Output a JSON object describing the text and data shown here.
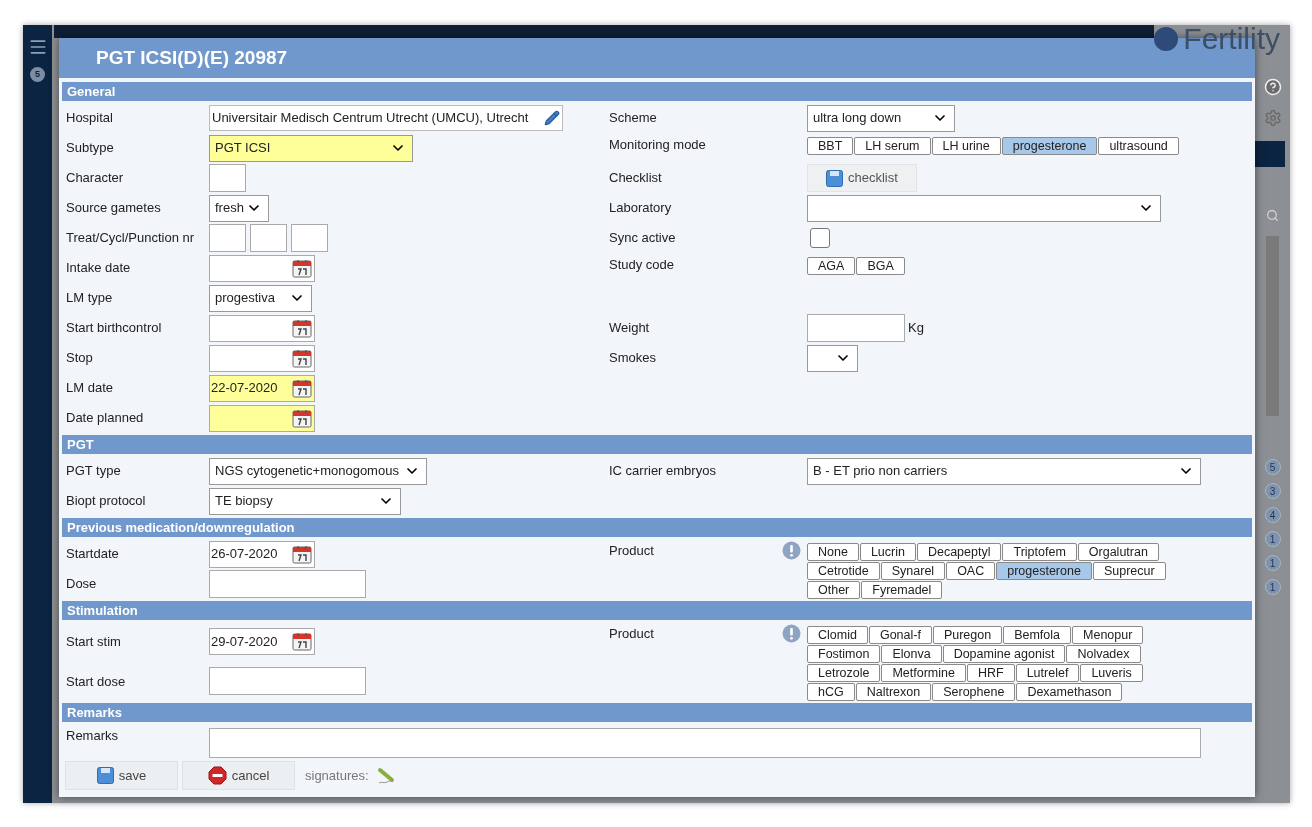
{
  "app": {
    "menu_badge": "5",
    "logo": "Fertility",
    "side_badges": [
      "5",
      "3",
      "4",
      "1",
      "1",
      "1"
    ]
  },
  "dialog": {
    "title": "PGT ICSI(D)(E) 20987"
  },
  "sections": [
    {
      "title": "General",
      "rows": [
        {
          "left": {
            "label": "Hospital",
            "kind": "lookup",
            "value": "Universitair Medisch Centrum Utrecht (UMCU), Utrecht",
            "highlighted": false
          },
          "right": {
            "label": "Scheme",
            "kind": "select",
            "value": "ultra long down",
            "highlighted": false
          }
        },
        {
          "left": {
            "label": "Subtype",
            "kind": "select",
            "value": "PGT ICSI",
            "highlighted": true
          },
          "right": {
            "label": "Monitoring mode",
            "kind": "toggles",
            "options": [
              {
                "label": "BBT",
                "selected": false
              },
              {
                "label": "LH serum",
                "selected": false
              },
              {
                "label": "LH urine",
                "selected": false
              },
              {
                "label": "progesterone",
                "selected": true
              },
              {
                "label": "ultrasound",
                "selected": false
              }
            ]
          }
        },
        {
          "left": {
            "label": "Character",
            "kind": "text",
            "highlighted": false
          },
          "right": {
            "label": "Checklist",
            "kind": "action",
            "button": "checklist"
          }
        },
        {
          "left": {
            "label": "Source gametes",
            "kind": "select",
            "value": "fresh",
            "highlighted": false
          },
          "right": {
            "label": "Laboratory",
            "kind": "select",
            "highlighted": false
          }
        },
        {
          "left": {
            "label": "Treat/Cycl/Punction nr",
            "kind": "triple"
          },
          "right": {
            "label": "Sync active",
            "kind": "checkbox",
            "checked": false
          }
        },
        {
          "left": {
            "label": "Intake date",
            "kind": "date",
            "highlighted": false
          },
          "right": {
            "label": "Study code",
            "kind": "toggles",
            "options": [
              {
                "label": "AGA",
                "selected": false
              },
              {
                "label": "BGA",
                "selected": false
              }
            ]
          }
        },
        {
          "left": {
            "label": "LM type",
            "kind": "select",
            "value": "progestiva",
            "highlighted": false
          }
        },
        {
          "left": {
            "label": "Start birthcontrol",
            "kind": "date",
            "highlighted": false
          },
          "right": {
            "label": "Weight",
            "kind": "measure",
            "unit": "Kg",
            "highlighted": false
          }
        },
        {
          "left": {
            "label": "Stop",
            "kind": "date",
            "highlighted": false
          },
          "right": {
            "label": "Smokes",
            "kind": "select",
            "highlighted": false
          }
        },
        {
          "left": {
            "label": "LM date",
            "kind": "date",
            "value": "22-07-2020",
            "highlighted": true
          }
        },
        {
          "left": {
            "label": "Date planned",
            "kind": "date",
            "highlighted": true
          }
        }
      ]
    },
    {
      "title": "PGT",
      "rows": [
        {
          "left": {
            "label": "PGT type",
            "kind": "select",
            "value": "NGS cytogenetic+monogomous",
            "highlighted": false
          },
          "right": {
            "label": "IC carrier embryos",
            "kind": "select",
            "value": "B - ET prio non carriers",
            "highlighted": false
          }
        },
        {
          "left": {
            "label": "Biopt protocol",
            "kind": "select",
            "value": "TE biopsy",
            "highlighted": false
          }
        }
      ]
    },
    {
      "title": "Previous medication/downregulation",
      "rows": [
        {
          "left": {
            "label": "Startdate",
            "kind": "date",
            "value": "26-07-2020",
            "highlighted": false
          },
          "right": {
            "label": "Product",
            "kind": "products",
            "options": [
              {
                "label": "None",
                "selected": false
              },
              {
                "label": "Lucrin",
                "selected": false
              },
              {
                "label": "Decapeptyl",
                "selected": false
              },
              {
                "label": "Triptofem",
                "selected": false
              },
              {
                "label": "Orgalutran",
                "selected": false
              },
              {
                "label": "Cetrotide",
                "selected": false
              },
              {
                "label": "Synarel",
                "selected": false
              },
              {
                "label": "OAC",
                "selected": false
              },
              {
                "label": "progesterone",
                "selected": true
              },
              {
                "label": "Suprecur",
                "selected": false
              },
              {
                "label": "Other",
                "selected": false
              },
              {
                "label": "Fyremadel",
                "selected": false
              }
            ]
          }
        },
        {
          "left": {
            "label": "Dose",
            "kind": "text",
            "highlighted": false
          }
        }
      ]
    },
    {
      "title": "Stimulation",
      "rows": [
        {
          "left": {
            "label": "Start stim",
            "kind": "date",
            "value": "29-07-2020",
            "highlighted": false
          },
          "right": {
            "label": "Product",
            "kind": "products",
            "options": [
              {
                "label": "Clomid",
                "selected": false
              },
              {
                "label": "Gonal-f",
                "selected": false
              },
              {
                "label": "Puregon",
                "selected": false
              },
              {
                "label": "Bemfola",
                "selected": false
              },
              {
                "label": "Menopur",
                "selected": false
              },
              {
                "label": "Fostimon",
                "selected": false
              },
              {
                "label": "Elonva",
                "selected": false
              },
              {
                "label": "Dopamine agonist",
                "selected": false
              },
              {
                "label": "Nolvadex",
                "selected": false
              },
              {
                "label": "Letrozole",
                "selected": false
              },
              {
                "label": "Metformine",
                "selected": false
              },
              {
                "label": "HRF",
                "selected": false
              },
              {
                "label": "Lutrelef",
                "selected": false
              },
              {
                "label": "Luveris",
                "selected": false
              },
              {
                "label": "hCG",
                "selected": false
              },
              {
                "label": "Naltrexon",
                "selected": false
              },
              {
                "label": "Serophene",
                "selected": false
              },
              {
                "label": "Dexamethason",
                "selected": false
              }
            ]
          }
        },
        {
          "left": {
            "label": "Start dose",
            "kind": "text",
            "highlighted": false
          }
        }
      ]
    },
    {
      "title": "Remarks",
      "rows": [
        {
          "left": {
            "label": "Remarks",
            "kind": "textarea",
            "highlighted": false
          }
        }
      ]
    }
  ],
  "footer": {
    "buttons": [
      {
        "label": "save",
        "kind": "save"
      },
      {
        "label": "cancel",
        "kind": "cancel"
      }
    ],
    "signatures_label": "signatures:"
  }
}
